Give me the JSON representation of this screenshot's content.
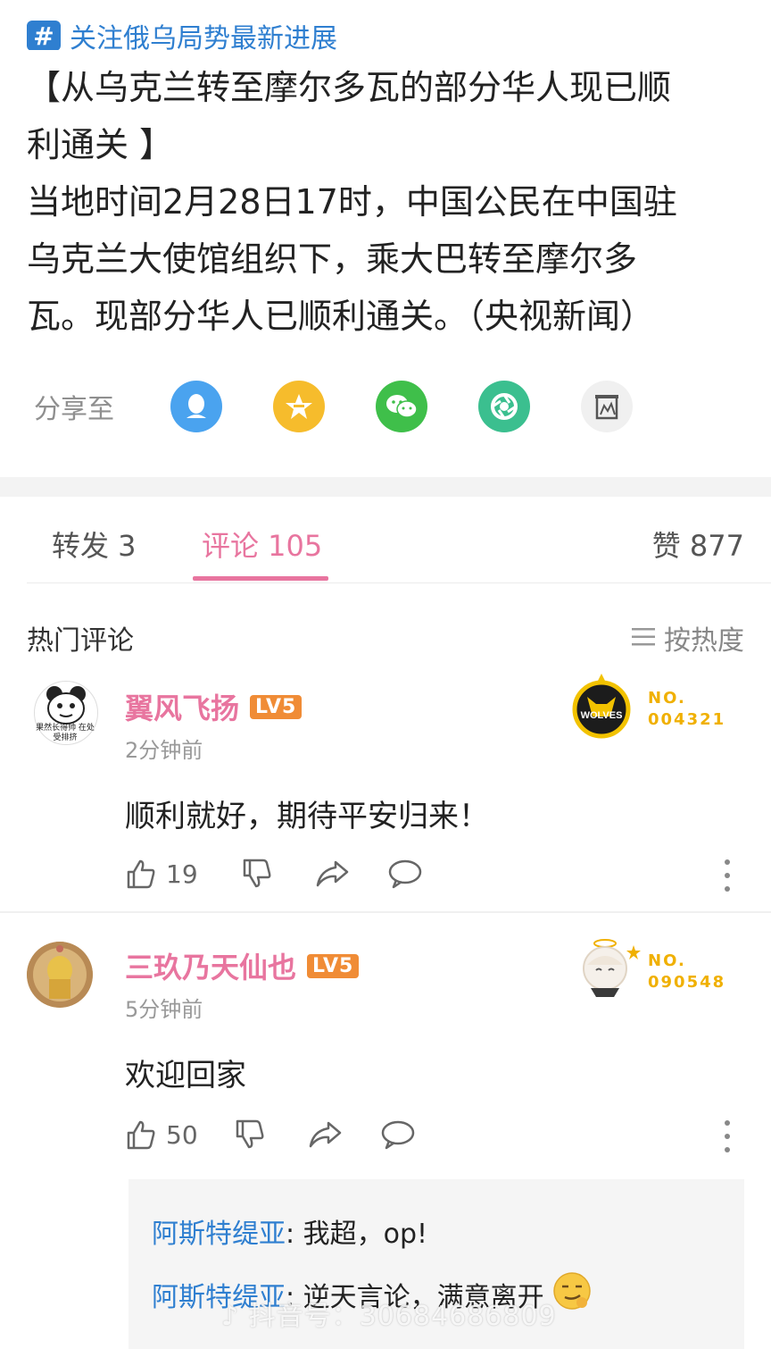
{
  "topic": {
    "text": "关注俄乌局势最新进展"
  },
  "article": {
    "lines": [
      "【从乌克兰转至摩尔多瓦的部分华人现已顺",
      "利通关 】",
      "当地时间2月28日17时，中国公民在中国驻",
      "乌克兰大使馆组织下，乘大巴转至摩尔多",
      "瓦。现部分华人已顺利通关。（央视新闻）"
    ]
  },
  "share": {
    "label": "分享至",
    "icons": [
      {
        "name": "qq-icon",
        "color": "#4aa3ef"
      },
      {
        "name": "qzone-icon",
        "color": "#f6bc2c"
      },
      {
        "name": "wechat-icon",
        "color": "#3fbf4a"
      },
      {
        "name": "moments-icon",
        "color": "#3bbf8f"
      },
      {
        "name": "weibo-icon",
        "color": "#f0f0f0"
      }
    ]
  },
  "tabs": {
    "repost": "转发 3",
    "comments": "评论 105",
    "likes": "赞 877"
  },
  "hot": {
    "title": "热门评论",
    "sort": "按热度"
  },
  "comments": [
    {
      "user": "翼风飞扬",
      "level": "LV5",
      "time": "2分钟前",
      "text": "顺利就好，期待平安归来！",
      "likes": "19",
      "avatar_caption": "果然长得帅 在处受排挤",
      "medal_label": "WOLVES",
      "medal_no": "NO.",
      "medal_num": "004321"
    },
    {
      "user": "三玖乃天仙也",
      "level": "LV5",
      "time": "5分钟前",
      "text": "欢迎回家",
      "likes": "50",
      "medal_no": "NO.",
      "medal_num": "090548"
    }
  ],
  "replies": [
    {
      "name": "阿斯特缇亚",
      "text": ": 我超，op!"
    },
    {
      "name": "阿斯特缇亚",
      "text": ": 逆天言论，满意离开"
    }
  ],
  "watermark": "抖音号：30684686809",
  "colors": {
    "accent": "#e8759f",
    "link": "#2f7fd0",
    "level": "#f08c36"
  }
}
